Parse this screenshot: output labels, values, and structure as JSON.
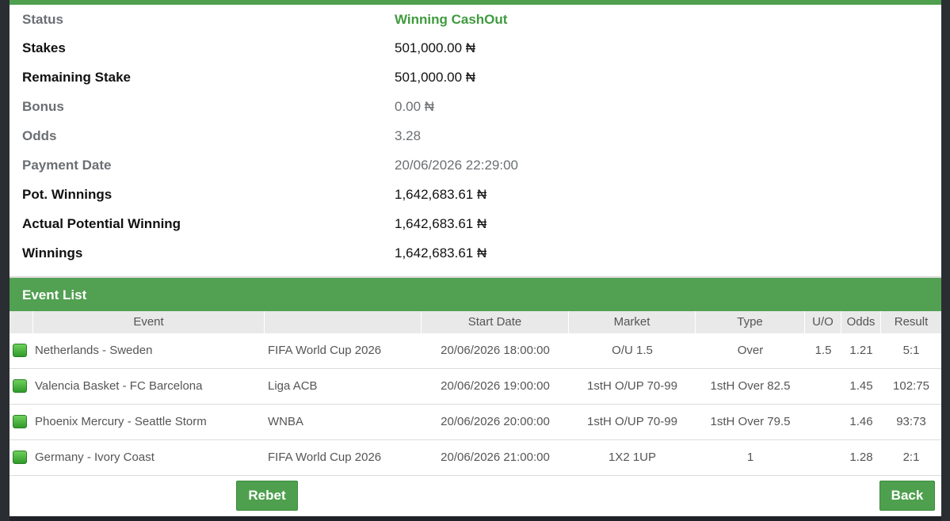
{
  "details": [
    {
      "label": "Status",
      "value": "Winning CashOut"
    },
    {
      "label": "Stakes",
      "value": "501,000.00 ₦"
    },
    {
      "label": "Remaining Stake",
      "value": "501,000.00 ₦"
    },
    {
      "label": "Bonus",
      "value": "0.00 ₦"
    },
    {
      "label": "Odds",
      "value": "3.28"
    },
    {
      "label": "Payment Date",
      "value": "20/06/2026 22:29:00"
    },
    {
      "label": "Pot. Winnings",
      "value": "1,642,683.61 ₦"
    },
    {
      "label": "Actual Potential Winning",
      "value": "1,642,683.61 ₦"
    },
    {
      "label": "Winnings",
      "value": "1,642,683.61 ₦"
    }
  ],
  "event_list": {
    "title": "Event List",
    "columns": {
      "event": "Event",
      "competition": "",
      "start_date": "Start Date",
      "market": "Market",
      "type": "Type",
      "uo": "U/O",
      "odds": "Odds",
      "result": "Result"
    },
    "rows": [
      {
        "event": "Netherlands - Sweden",
        "competition": "FIFA World Cup 2026",
        "start_date": "20/06/2026 18:00:00",
        "market": "O/U 1.5",
        "type": "Over",
        "uo": "1.5",
        "odds": "1.21",
        "result": "5:1"
      },
      {
        "event": "Valencia Basket - FC Barcelona",
        "competition": "Liga ACB",
        "start_date": "20/06/2026 19:00:00",
        "market": "1stH O/UP 70-99",
        "type": "1stH Over 82.5",
        "uo": "",
        "odds": "1.45",
        "result": "102:75"
      },
      {
        "event": "Phoenix Mercury - Seattle Storm",
        "competition": "WNBA",
        "start_date": "20/06/2026 20:00:00",
        "market": "1stH O/UP 70-99",
        "type": "1stH Over 79.5",
        "uo": "",
        "odds": "1.46",
        "result": "93:73"
      },
      {
        "event": "Germany - Ivory Coast",
        "competition": "FIFA World Cup 2026",
        "start_date": "20/06/2026 21:00:00",
        "market": "1X2 1UP",
        "type": "1",
        "uo": "",
        "odds": "1.28",
        "result": "2:1"
      }
    ]
  },
  "buttons": {
    "rebet": "Rebet",
    "back": "Back"
  },
  "colors": {
    "accent_green": "#4e9f4e",
    "status_green": "#3f9b3f"
  },
  "icons": {
    "row_status": "green-status-square-icon"
  }
}
